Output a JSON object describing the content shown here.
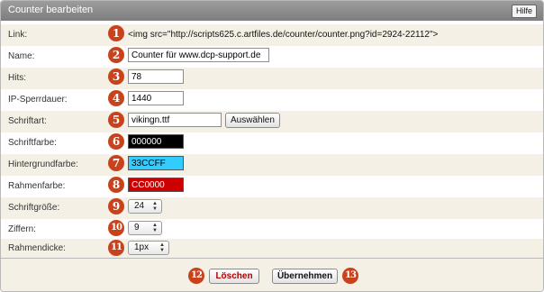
{
  "header": {
    "title": "Counter bearbeiten",
    "help_label": "Hilfe"
  },
  "form": {
    "link": {
      "label": "Link:",
      "badge": "1",
      "value": "<img src=\"http://scripts625.c.artfiles.de/counter/counter.png?id=2924-22112\">"
    },
    "name": {
      "label": "Name:",
      "badge": "2",
      "value": "Counter für www.dcp-support.de"
    },
    "hits": {
      "label": "Hits:",
      "badge": "3",
      "value": "78"
    },
    "ip_block": {
      "label": "IP-Sperrdauer:",
      "badge": "4",
      "value": "1440"
    },
    "font": {
      "label": "Schriftart:",
      "badge": "5",
      "value": "vikingn.ttf",
      "button_label": "Auswählen"
    },
    "font_color": {
      "label": "Schriftfarbe:",
      "badge": "6",
      "value": "000000",
      "bg": "#000000",
      "fg": "#ffffff"
    },
    "bg_color": {
      "label": "Hintergrundfarbe:",
      "badge": "7",
      "value": "33CCFF",
      "bg": "#33CCFF",
      "fg": "#000000"
    },
    "frame_color": {
      "label": "Rahmenfarbe:",
      "badge": "8",
      "value": "CC0000",
      "bg": "#CC0000",
      "fg": "#ffffff"
    },
    "font_size": {
      "label": "Schriftgröße:",
      "badge": "9",
      "value": "24"
    },
    "digits": {
      "label": "Ziffern:",
      "badge": "10",
      "value": "9"
    },
    "frame_width": {
      "label": "Rahmendicke:",
      "badge": "11",
      "value": "1px"
    }
  },
  "footer": {
    "delete_badge": "12",
    "delete_label": "Löschen",
    "delete_color": "#b00000",
    "apply_badge": "13",
    "apply_label": "Übernehmen"
  }
}
